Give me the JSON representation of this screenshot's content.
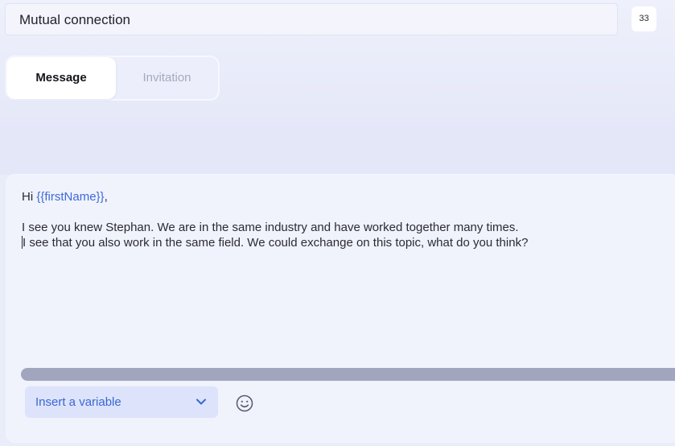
{
  "header": {
    "name_field_value": "Mutual connection",
    "counter": "33"
  },
  "tabs": [
    {
      "label": "Message",
      "active": true
    },
    {
      "label": "Invitation",
      "active": false
    }
  ],
  "editor": {
    "greeting_prefix": "Hi ",
    "greeting_variable": "{{firstName}}",
    "greeting_suffix": ",",
    "line1": "I see you knew Stephan. We are in the same industry and have worked together many times.",
    "line2": "I see that you also work in the same field. We could exchange on this topic, what do you think?"
  },
  "toolbar": {
    "insert_variable_label": "Insert a variable",
    "chevron_icon": "chevron-down-icon",
    "emoji_icon": "smiley-icon"
  },
  "colors": {
    "accent": "#3a67d4",
    "variable": "#3d6bd6",
    "background": "#e9ecf9"
  }
}
